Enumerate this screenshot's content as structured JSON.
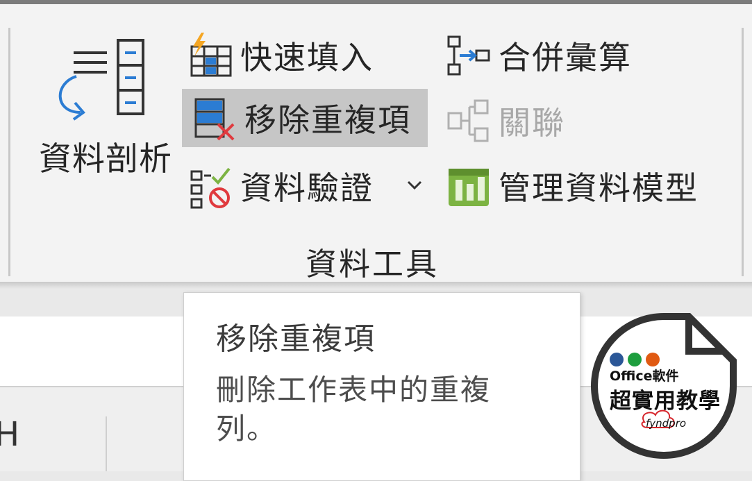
{
  "ribbon": {
    "group_label": "資料工具",
    "data_profile_label": "資料剖析",
    "flash_fill_label": "快速填入",
    "remove_duplicates_label": "移除重複項",
    "data_validation_label": "資料驗證",
    "consolidate_label": "合併彙算",
    "relationships_label": "關聯",
    "manage_data_model_label": "管理資料模型"
  },
  "sheet": {
    "column_header": "H"
  },
  "tooltip": {
    "title": "移除重複項",
    "description": "刪除工作表中的重複列。"
  },
  "logo": {
    "top_text": "Office軟件",
    "main_text": "超實用教學",
    "sub_text": "fyndpro"
  },
  "colors": {
    "accent_blue": "#2b7cd3",
    "accent_red": "#e03a3e",
    "accent_green": "#7cb342",
    "hover_bg": "#c6c6c6"
  }
}
